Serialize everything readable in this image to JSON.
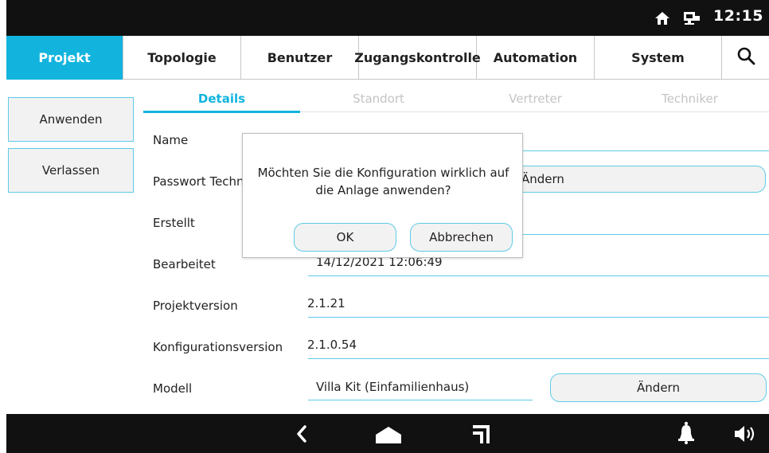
{
  "status_bar": {
    "time": "12:15",
    "icons": [
      "home-icon",
      "network-icon"
    ]
  },
  "nav": {
    "tabs": [
      {
        "label": "Projekt",
        "active": true
      },
      {
        "label": "Topologie",
        "active": false
      },
      {
        "label": "Benutzer",
        "active": false
      },
      {
        "label": "Zugangskontrolle",
        "active": false
      },
      {
        "label": "Automation",
        "active": false
      },
      {
        "label": "System",
        "active": false
      }
    ],
    "search_icon": "search-icon"
  },
  "sidebar": {
    "apply_label": "Anwenden",
    "exit_label": "Verlassen"
  },
  "subtabs": [
    {
      "label": "Details",
      "active": true
    },
    {
      "label": "Standort",
      "active": false
    },
    {
      "label": "Vertreter",
      "active": false
    },
    {
      "label": "Techniker",
      "active": false
    }
  ],
  "form": {
    "name_label": "Name",
    "password_label": "Passwort Techn",
    "password_button": "Ändern",
    "created_label": "Erstellt",
    "edited_label": "Bearbeitet",
    "edited_value": "14/12/2021 12:06:49",
    "project_version_label": "Projektversion",
    "project_version_value": "2.1.21",
    "config_version_label": "Konfigurationsversion",
    "config_version_value": "2.1.0.54",
    "model_label": "Modell",
    "model_value": "Villa Kit (Einfamilienhaus)",
    "model_button": "Ändern"
  },
  "dialog": {
    "message": "Möchten Sie die Konfiguration wirklich auf die Anlage anwenden?",
    "ok_label": "OK",
    "cancel_label": "Abbrechen"
  },
  "bottom_bar": {
    "icons": [
      "back-icon",
      "home-icon",
      "recent-apps-icon",
      "bell-icon",
      "speaker-icon"
    ]
  },
  "colors": {
    "accent": "#12b4de",
    "field_border": "#5ecbe6",
    "bar_background": "#111111"
  }
}
